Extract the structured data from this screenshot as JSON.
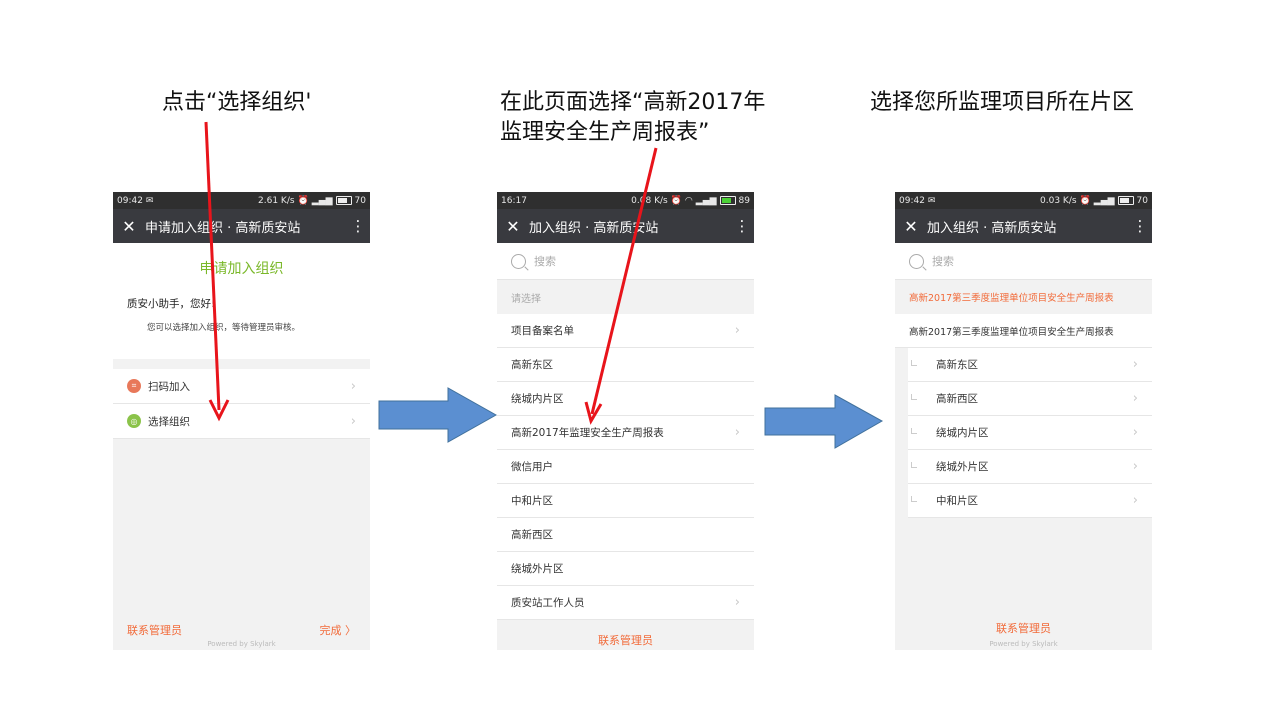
{
  "captions": {
    "step1": "点击“选择组织'",
    "step2": "在此页面选择“高新2017年\n监理安全生产周报表”",
    "step3": "选择您所监理项目所在片区"
  },
  "phone1": {
    "status": {
      "time": "09:42",
      "speed": "2.61 K/s",
      "battery": "70"
    },
    "topbar": {
      "title": "申请加入组织 · 高新质安站"
    },
    "heading": "申请加入组织",
    "greeting": "质安小助手，您好!",
    "subtext": "您可以选择加入组织，等待管理员审核。",
    "items": [
      {
        "label": "扫码加入",
        "icon": "scan-icon",
        "color": "#e8785a"
      },
      {
        "label": "选择组织",
        "icon": "org-icon",
        "color": "#8bc34a"
      }
    ],
    "footer": {
      "left": "联系管理员",
      "powered": "Powered by Skylark",
      "right": "完成 〉"
    }
  },
  "phone2": {
    "status": {
      "time": "16:17",
      "speed": "0.08 K/s",
      "battery": "89"
    },
    "topbar": {
      "title": "加入组织 · 高新质安站"
    },
    "search_placeholder": "搜索",
    "section": "请选择",
    "items": [
      {
        "label": "项目备案名单",
        "chevron": true
      },
      {
        "label": "高新东区",
        "chevron": false
      },
      {
        "label": "绕城内片区",
        "chevron": false
      },
      {
        "label": "高新2017年监理安全生产周报表",
        "chevron": true
      },
      {
        "label": "微信用户",
        "chevron": false
      },
      {
        "label": "中和片区",
        "chevron": false
      },
      {
        "label": "高新西区",
        "chevron": false
      },
      {
        "label": "绕城外片区",
        "chevron": false
      },
      {
        "label": "质安站工作人员",
        "chevron": true
      }
    ],
    "footer": {
      "link": "联系管理员"
    }
  },
  "phone3": {
    "status": {
      "time": "09:42",
      "speed": "0.03 K/s",
      "battery": "70"
    },
    "topbar": {
      "title": "加入组织 · 高新质安站"
    },
    "search_placeholder": "搜索",
    "section": "高新2017第三季度监理单位项目安全生产周报表",
    "parent": "高新2017第三季度监理单位项目安全生产周报表",
    "items": [
      {
        "label": "高新东区"
      },
      {
        "label": "高新西区"
      },
      {
        "label": "绕城内片区"
      },
      {
        "label": "绕城外片区"
      },
      {
        "label": "中和片区"
      }
    ],
    "footer": {
      "link": "联系管理员",
      "powered": "Powered by Skylark"
    }
  },
  "colors": {
    "annotation_red": "#e8141b",
    "arrow_blue": "#5b8fd1",
    "accent_orange": "#f26b3a",
    "accent_green": "#7ab829",
    "topbar": "#393a3f"
  }
}
